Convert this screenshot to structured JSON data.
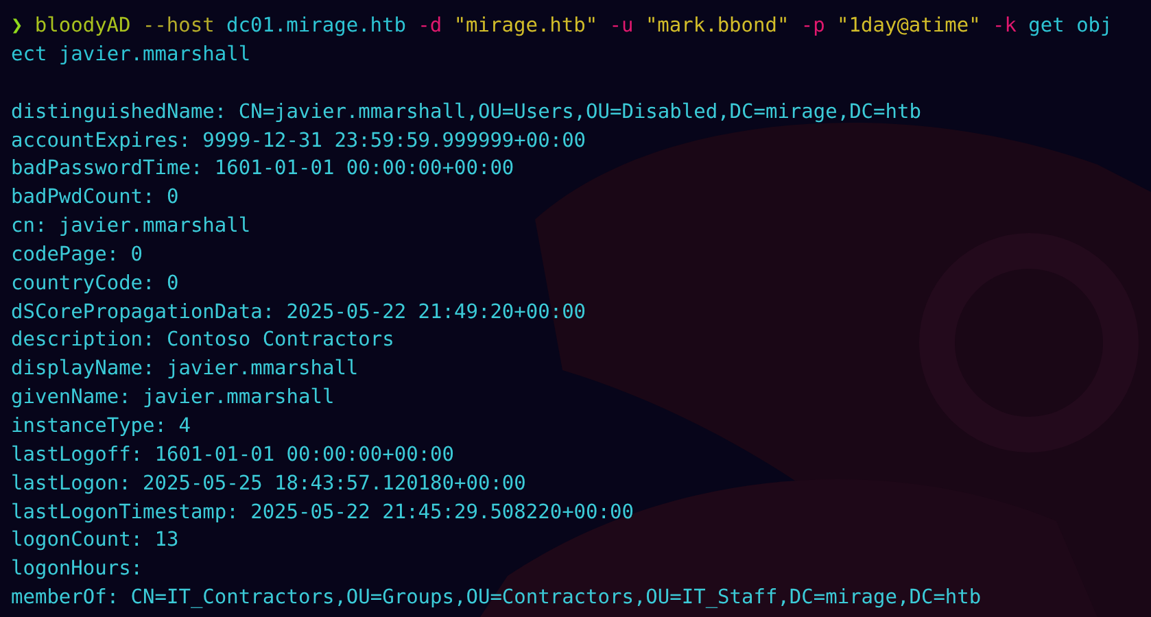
{
  "command": {
    "tokens": [
      {
        "text": "❯",
        "kind": "prompt"
      },
      {
        "text": "bloodyAD",
        "kind": "program"
      },
      {
        "text": "--host",
        "kind": "option"
      },
      {
        "text": "dc01.mirage.htb",
        "kind": "argument"
      },
      {
        "text": "-d",
        "kind": "flag"
      },
      {
        "text": "\"mirage.htb\"",
        "kind": "string"
      },
      {
        "text": "-u",
        "kind": "flag"
      },
      {
        "text": "\"mark.bbond\"",
        "kind": "string"
      },
      {
        "text": "-p",
        "kind": "flag"
      },
      {
        "text": "\"1day@atime\"",
        "kind": "string"
      },
      {
        "text": "-k",
        "kind": "flag"
      },
      {
        "text": "get obj",
        "kind": "argument"
      }
    ],
    "continuation": "ect javier.mmarshall"
  },
  "output": [
    "distinguishedName: CN=javier.mmarshall,OU=Users,OU=Disabled,DC=mirage,DC=htb",
    "accountExpires: 9999-12-31 23:59:59.999999+00:00",
    "badPasswordTime: 1601-01-01 00:00:00+00:00",
    "badPwdCount: 0",
    "cn: javier.mmarshall",
    "codePage: 0",
    "countryCode: 0",
    "dSCorePropagationData: 2025-05-22 21:49:20+00:00",
    "description: Contoso Contractors",
    "displayName: javier.mmarshall",
    "givenName: javier.mmarshall",
    "instanceType: 4",
    "lastLogoff: 1601-01-01 00:00:00+00:00",
    "lastLogon: 2025-05-25 18:43:57.120180+00:00",
    "lastLogonTimestamp: 2025-05-22 21:45:29.508220+00:00",
    "logonCount: 13",
    "logonHours:",
    "memberOf: CN=IT_Contractors,OU=Groups,OU=Contractors,OU=IT_Staff,DC=mirage,DC=htb"
  ]
}
